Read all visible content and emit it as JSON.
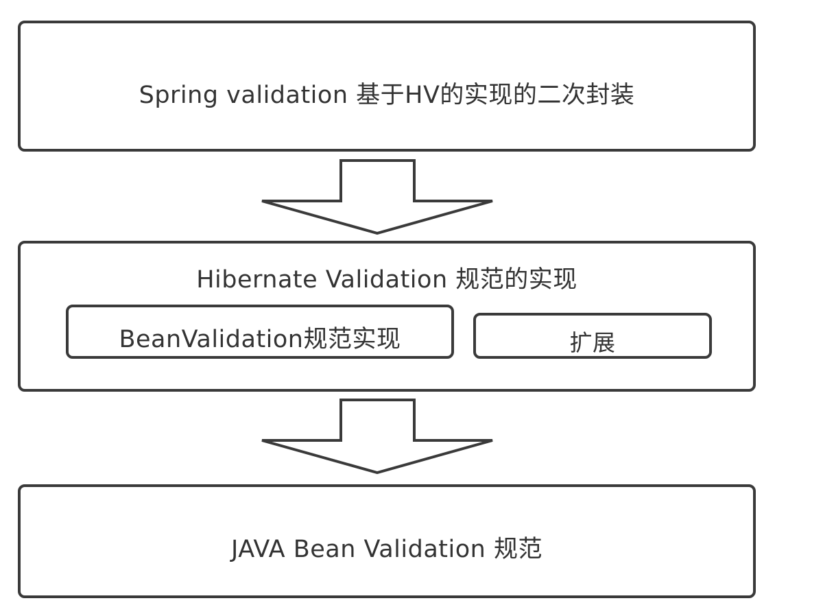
{
  "diagram": {
    "layers": [
      {
        "id": "spring",
        "label": "Spring validation 基于HV的实现的二次封装"
      },
      {
        "id": "hibernate",
        "label": "Hibernate Validation 规范的实现",
        "children": [
          {
            "id": "bean-impl",
            "label": "BeanValidation规范实现"
          },
          {
            "id": "extension",
            "label": "扩展"
          }
        ]
      },
      {
        "id": "javabean",
        "label": "JAVA Bean Validation 规范"
      }
    ],
    "colors": {
      "stroke": "#3a3a3a",
      "text": "#333333",
      "background": "#ffffff"
    }
  }
}
